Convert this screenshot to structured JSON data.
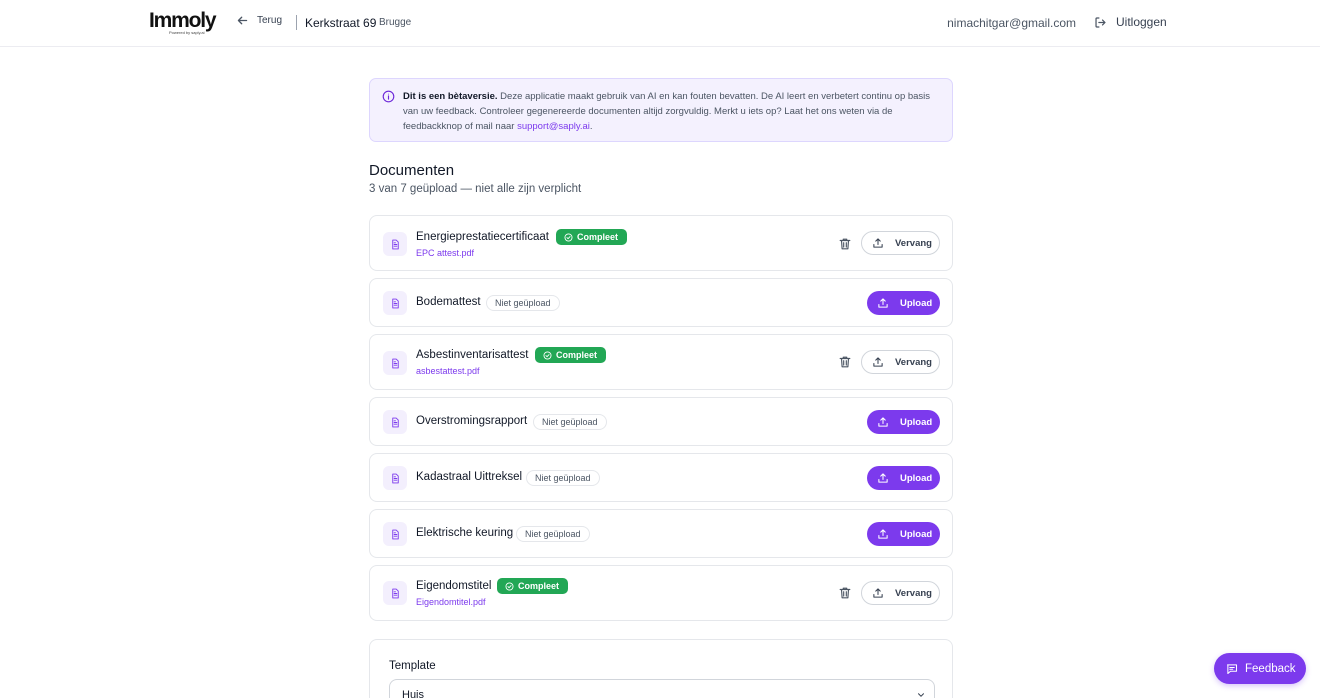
{
  "header": {
    "logo_text": "Immoly",
    "logo_subtext": "Powered by saply.ai",
    "back_label": "Terug",
    "address": "Kerkstraat 69",
    "city": "Brugge",
    "email": "nimachitgar@gmail.com",
    "logout_label": "Uitloggen"
  },
  "notice": {
    "bold": "Dit is een bètaversie.",
    "text": " Deze applicatie maakt gebruik van AI en kan fouten bevatten. De AI leert en verbetert continu op basis van uw feedback. Controleer gegenereerde documenten altijd zorgvuldig. Merkt u iets op? Laat het ons weten via de feedbackknop of mail naar ",
    "link": "support@saply.ai",
    "suffix": "."
  },
  "documents": {
    "title": "Documenten",
    "subtitle": "3 van 7 geüpload — niet alle zijn verplicht",
    "items": [
      {
        "name": "Energieprestatiecertificaat",
        "status": "Compleet",
        "file": "EPC attest.pdf",
        "action": "Vervang"
      },
      {
        "name": "Bodemattest",
        "status": "Niet geüpload",
        "action": "Upload"
      },
      {
        "name": "Asbestinventarisattest",
        "status": "Compleet",
        "file": "asbestattest.pdf",
        "action": "Vervang"
      },
      {
        "name": "Overstromingsrapport",
        "status": "Niet geüpload",
        "action": "Upload"
      },
      {
        "name": "Kadastraal Uittreksel",
        "status": "Niet geüpload",
        "action": "Upload"
      },
      {
        "name": "Elektrische keuring",
        "status": "Niet geüpload",
        "action": "Upload"
      },
      {
        "name": "Eigendomstitel",
        "status": "Compleet",
        "file": "Eigendomtitel.pdf",
        "action": "Vervang"
      }
    ]
  },
  "template": {
    "label": "Template",
    "value": "Huis"
  },
  "feedback_label": "Feedback",
  "colors": {
    "accent": "#7c3aed",
    "success": "#22a755",
    "notice_bg": "#f4f1fe"
  }
}
